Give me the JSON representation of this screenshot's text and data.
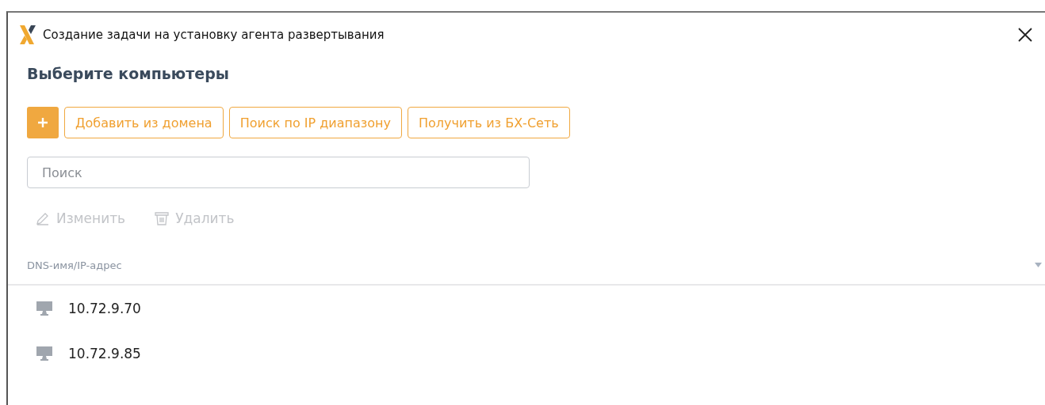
{
  "window": {
    "title": "Создание задачи на установку агента развертывания"
  },
  "heading": "Выберите компьютеры",
  "add_buttons": [
    {
      "label": "Добавить из домена"
    },
    {
      "label": "Поиск по IP диапазону"
    },
    {
      "label": "Получить из БХ-Сеть"
    }
  ],
  "search": {
    "placeholder": "Поиск"
  },
  "actions": [
    {
      "kind": "edit",
      "label": "Изменить",
      "disabled": true
    },
    {
      "kind": "delete",
      "label": "Удалить",
      "disabled": true
    }
  ],
  "table": {
    "columns": [
      "DNS-имя/IP-адрес"
    ],
    "rows": [
      {
        "address": "10.72.9.70"
      },
      {
        "address": "10.72.9.85"
      }
    ]
  }
}
